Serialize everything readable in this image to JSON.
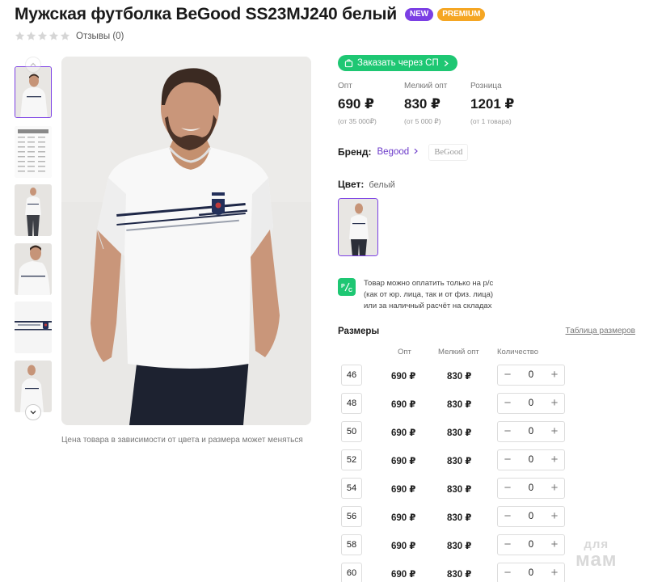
{
  "product": {
    "title": "Мужская футболка BeGood SS23MJ240 белый",
    "badges": {
      "new": "NEW",
      "premium": "PREMIUM"
    },
    "rating": {
      "stars": 0,
      "max": 5,
      "reviews_label": "Отзывы (0)"
    },
    "photo_note": "Цена товара в зависимости от цвета и размера может меняться"
  },
  "order_button": {
    "label": "Заказать через СП",
    "icon": "bag-icon"
  },
  "prices": [
    {
      "label": "Опт",
      "value": "690 ₽",
      "min": "(от 35 000₽)"
    },
    {
      "label": "Мелкий опт",
      "value": "830 ₽",
      "min": "(от 5 000 ₽)"
    },
    {
      "label": "Розница",
      "value": "1201 ₽",
      "min": "(от 1 товара)"
    }
  ],
  "brand": {
    "label": "Бренд:",
    "name": "Begood",
    "logo_text": "BeGood"
  },
  "color": {
    "label": "Цвет:",
    "value": "белый"
  },
  "payment_note": {
    "icon_text": "Р/С",
    "line1": "Товар можно оплатить только на р/с",
    "line2": "(как от юр. лица, так и от физ. лица)",
    "line3": "или за наличный расчёт на складах"
  },
  "sizes": {
    "title": "Размеры",
    "table_link": "Таблица размеров",
    "columns": {
      "opt": "Опт",
      "small_opt": "Мелкий опт",
      "qty": "Количество"
    },
    "rows": [
      {
        "size": "46",
        "opt": "690 ₽",
        "small_opt": "830 ₽",
        "qty": "0"
      },
      {
        "size": "48",
        "opt": "690 ₽",
        "small_opt": "830 ₽",
        "qty": "0"
      },
      {
        "size": "50",
        "opt": "690 ₽",
        "small_opt": "830 ₽",
        "qty": "0"
      },
      {
        "size": "52",
        "opt": "690 ₽",
        "small_opt": "830 ₽",
        "qty": "0"
      },
      {
        "size": "54",
        "opt": "690 ₽",
        "small_opt": "830 ₽",
        "qty": "0"
      },
      {
        "size": "56",
        "opt": "690 ₽",
        "small_opt": "830 ₽",
        "qty": "0"
      },
      {
        "size": "58",
        "opt": "690 ₽",
        "small_opt": "830 ₽",
        "qty": "0"
      },
      {
        "size": "60",
        "opt": "690 ₽",
        "small_opt": "830 ₽",
        "qty": "0"
      }
    ]
  },
  "watermark": {
    "line1": "для",
    "line2": "мам"
  },
  "colors": {
    "accent": "#7b3fe4",
    "green": "#1ec773",
    "premium": "#f5a623"
  }
}
